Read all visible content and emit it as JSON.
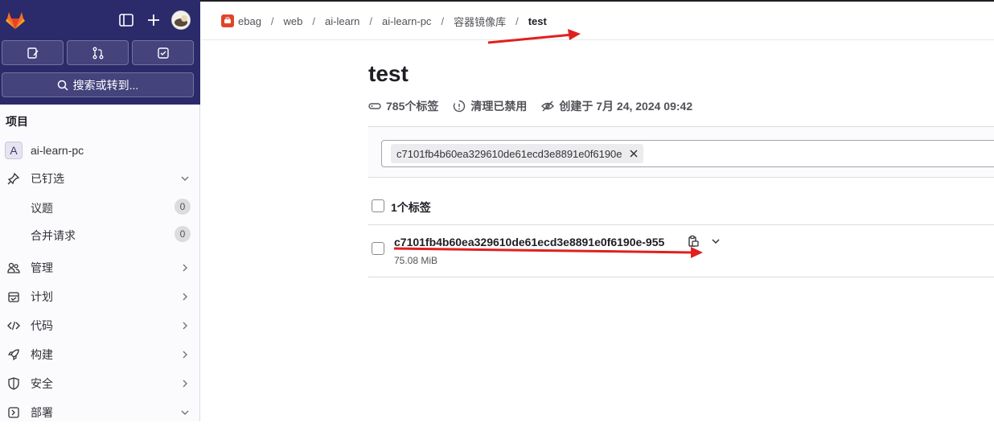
{
  "sidebar": {
    "search_label": "搜索或转到...",
    "section_title": "项目",
    "project": {
      "avatar_letter": "A",
      "name": "ai-learn-pc"
    },
    "pinned_label": "已钉选",
    "pinned_items": [
      {
        "label": "议题",
        "count": "0"
      },
      {
        "label": "合并请求",
        "count": "0"
      }
    ],
    "nav": [
      {
        "label": "管理"
      },
      {
        "label": "计划"
      },
      {
        "label": "代码"
      },
      {
        "label": "构建"
      },
      {
        "label": "安全"
      },
      {
        "label": "部署"
      }
    ]
  },
  "breadcrumb": [
    "ebag",
    "web",
    "ai-learn",
    "ai-learn-pc",
    "容器镜像库",
    "test"
  ],
  "main": {
    "title": "test",
    "meta": {
      "tags_count": "785个标签",
      "cleanup": "清理已禁用",
      "created": "创建于 7月 24, 2024 09:42"
    },
    "filter_token": "c7101fb4b60ea329610de61ecd3e8891e0f6190e",
    "list_header": "1个标签",
    "tags": [
      {
        "name": "c7101fb4b60ea329610de61ecd3e8891e0f6190e-955",
        "size": "75.08 MiB"
      }
    ]
  },
  "colors": {
    "sidebar_top": "#2b2a6a",
    "annotation_arrow": "#e0201e"
  }
}
